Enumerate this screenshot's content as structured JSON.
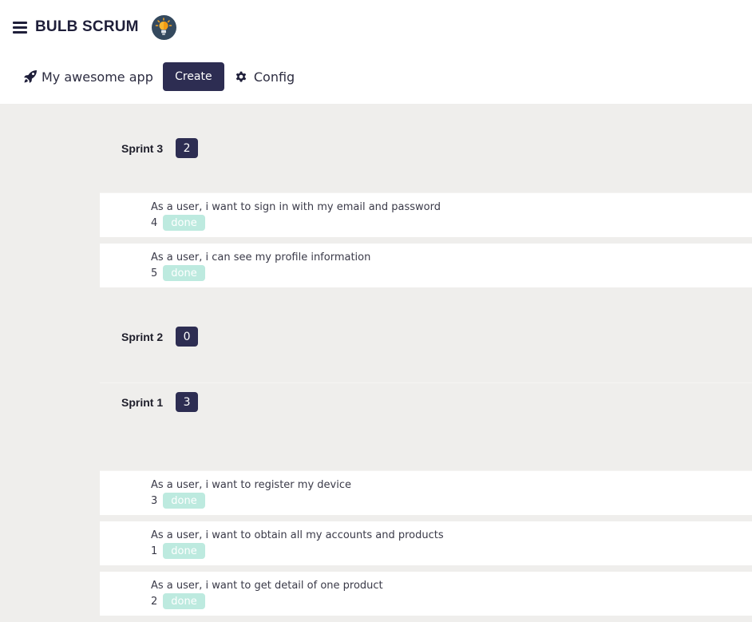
{
  "header": {
    "menu_icon": "hamburger-menu-icon",
    "brand_title": "BULB SCRUM",
    "logo_icon": "lightbulb-icon"
  },
  "nav": {
    "app_icon": "rocket-icon",
    "app_name": "My awesome app",
    "create_label": "Create",
    "config_icon": "gear-icon",
    "config_label": "Config"
  },
  "colors": {
    "primary": "#2d2d52",
    "background": "#efeeec",
    "done_badge": "#bdeadf"
  },
  "sprints": [
    {
      "name": "Sprint 3",
      "count": "2",
      "stories": [
        {
          "title": "As a user, i want to sign in with my email and password",
          "points": "4",
          "status": "done"
        },
        {
          "title": "As a user, i can see my profile information",
          "points": "5",
          "status": "done"
        }
      ]
    },
    {
      "name": "Sprint 2",
      "count": "0",
      "stories": []
    },
    {
      "name": "Sprint 1",
      "count": "3",
      "stories": [
        {
          "title": "As a user, i want to register my device",
          "points": "3",
          "status": "done"
        },
        {
          "title": "As a user, i want to obtain all my accounts and products",
          "points": "1",
          "status": "done"
        },
        {
          "title": "As a user, i want to get detail of one product",
          "points": "2",
          "status": "done"
        }
      ]
    }
  ]
}
